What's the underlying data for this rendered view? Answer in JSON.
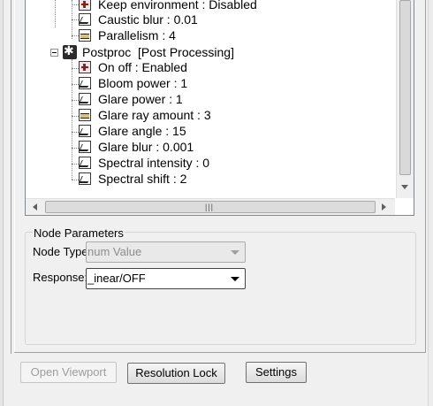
{
  "tree": {
    "top_items": [
      {
        "label": "Keep environment : Disabled",
        "icon": "toggle-icon"
      },
      {
        "label": "Caustic blur : 0.01",
        "icon": "curve-icon"
      },
      {
        "label": "Parallelism : 4",
        "icon": "bar-icon"
      }
    ],
    "postproc": {
      "label": "Postproc  [Post Processing]",
      "icon": "gear-icon",
      "items": [
        {
          "label": "On off : Enabled",
          "icon": "toggle-icon"
        },
        {
          "label": "Bloom power : 1",
          "icon": "curve-icon"
        },
        {
          "label": "Glare power : 1",
          "icon": "curve-icon"
        },
        {
          "label": "Glare ray amount : 3",
          "icon": "bar-icon"
        },
        {
          "label": "Glare angle : 15",
          "icon": "curve-icon"
        },
        {
          "label": "Glare blur : 0.001",
          "icon": "curve-icon"
        },
        {
          "label": "Spectral intensity : 0",
          "icon": "curve-icon"
        },
        {
          "label": "Spectral shift : 2",
          "icon": "curve-icon"
        }
      ]
    }
  },
  "node_params": {
    "title": "Node Parameters",
    "node_type_label": "Node Type:",
    "node_type_value": "num Value",
    "response_label": "Response:",
    "response_value": "_inear/OFF"
  },
  "buttons": {
    "open_viewport": "Open Viewport",
    "resolution_lock": "Resolution Lock",
    "settings": "Settings"
  }
}
